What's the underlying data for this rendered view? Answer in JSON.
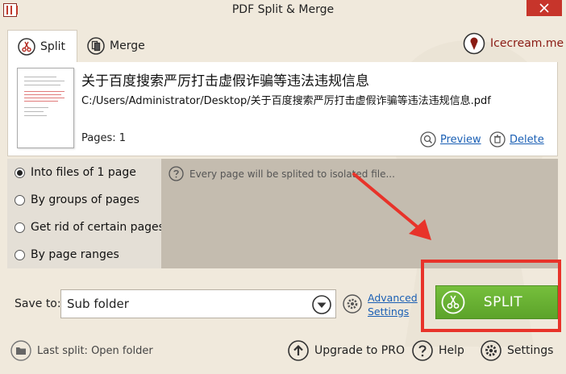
{
  "window": {
    "title": "PDF Split & Merge"
  },
  "tabs": [
    {
      "label": "Split"
    },
    {
      "label": "Merge"
    }
  ],
  "brand": {
    "name": "Icecream.me"
  },
  "file": {
    "name": "关于百度搜索严厉打击虚假诈骗等违法违规信息",
    "path": "C:/Users/Administrator/Desktop/关于百度搜索严厉打击虚假诈骗等违法违规信息.pdf",
    "pages": "Pages: 1",
    "preview_label": "Preview",
    "delete_label": "Delete"
  },
  "split_options": [
    {
      "label": "Into files of 1 page",
      "selected": true
    },
    {
      "label": "By groups of pages",
      "selected": false
    },
    {
      "label": "Get rid of certain pages",
      "selected": false
    },
    {
      "label": "By page ranges",
      "selected": false
    }
  ],
  "description": "Every page will be splited to isolated file...",
  "save": {
    "label": "Save to:",
    "value": "Sub folder",
    "advanced_line1": "Advanced",
    "advanced_line2": "Settings"
  },
  "split_button": {
    "label": "SPLIT"
  },
  "footer": {
    "last_split": "Last split: Open folder",
    "upgrade": "Upgrade to PRO",
    "help": "Help",
    "settings": "Settings"
  },
  "colors": {
    "background": "#f0e9dc",
    "accent_green": "#6ab334",
    "annotation_red": "#e8332a",
    "link_blue": "#1a5fb4",
    "close_red": "#c7352b"
  }
}
